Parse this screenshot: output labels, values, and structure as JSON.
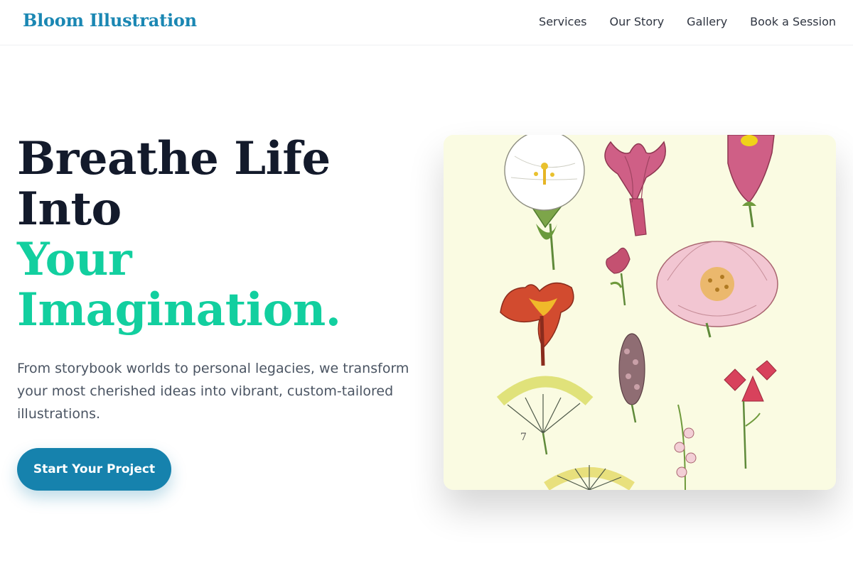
{
  "brand": {
    "name": "Bloom Illustration"
  },
  "nav": {
    "items": [
      "Services",
      "Our Story",
      "Gallery",
      "Book a Session"
    ]
  },
  "hero": {
    "title_line1": "Breathe Life",
    "title_line2": "Into",
    "title_line3": "Your",
    "title_line4": "Imagination.",
    "lead": "From storybook worlds to personal legacies, we transform your most cherished ideas into vibrant, custom-tailored illustrations.",
    "cta_label": "Start Your Project"
  },
  "colors": {
    "brand": "#1a87b3",
    "title_dark": "#131a2b",
    "title_accent": "#12cf9f",
    "cta_bg": "#1682ad",
    "art_bg": "#fafbe2"
  },
  "illustration": {
    "plate_number": "7"
  }
}
